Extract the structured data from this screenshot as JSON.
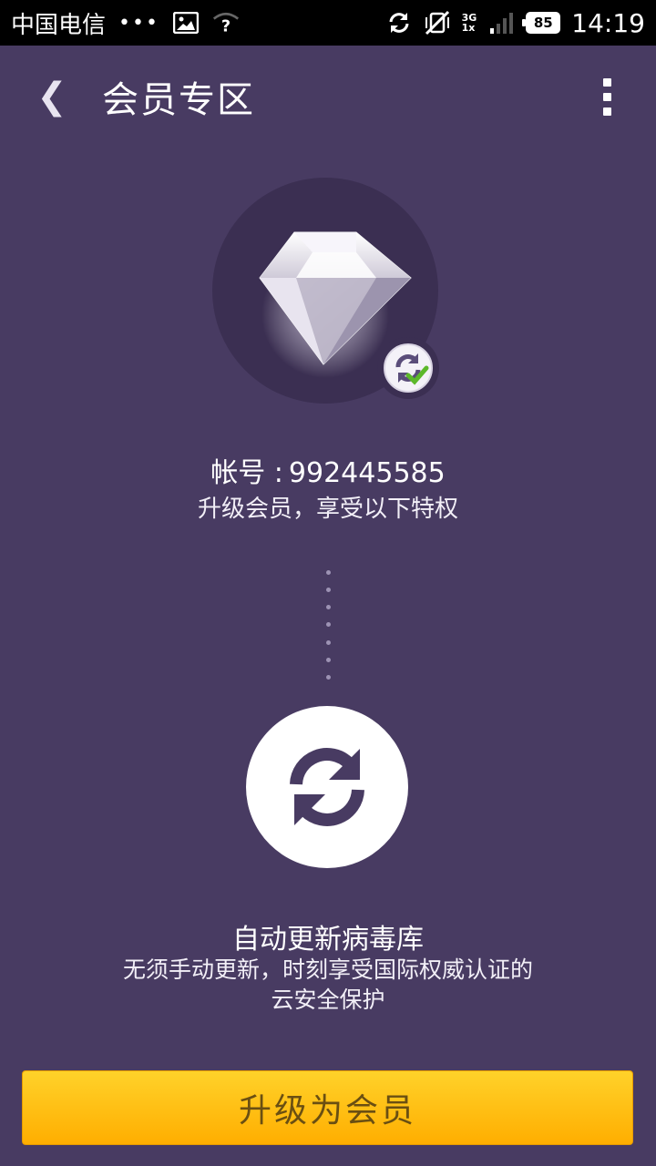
{
  "status_bar": {
    "carrier": "中国电信",
    "dots": "•••",
    "network_top": "3G",
    "network_bottom": "1x",
    "battery": "85",
    "time": "14:19"
  },
  "appbar": {
    "back_glyph": "❮",
    "title": "会员专区"
  },
  "account": {
    "label": "帐号 :",
    "number": "992445585",
    "subtitle": "升级会员，享受以下特权"
  },
  "feature": {
    "title": "自动更新病毒库",
    "desc_line1": "无须手动更新，时刻享受国际权威认证的",
    "desc_line2": "云安全保护"
  },
  "upgrade_button": {
    "label": "升级为会员"
  },
  "colors": {
    "background": "#483b62",
    "button": "#ffc107",
    "check": "#5cb82a"
  },
  "icons": [
    "image-icon",
    "wifi-question-icon",
    "sync-icon",
    "vibrate-mute-icon",
    "signal-icon",
    "battery-icon",
    "diamond-icon",
    "sync-check-icon",
    "auto-update-icon",
    "more-vert-icon"
  ]
}
